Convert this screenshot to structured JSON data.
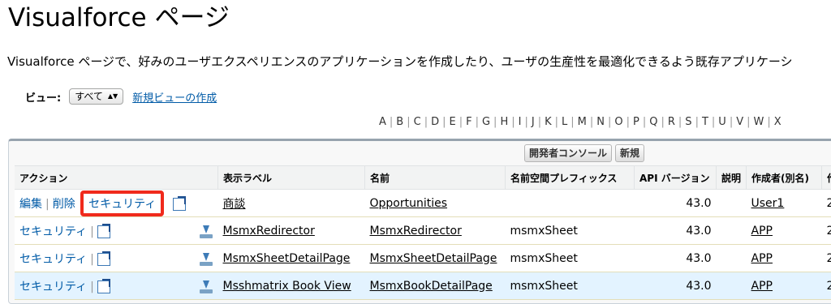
{
  "page": {
    "title": "Visualforce ページ",
    "description": "Visualforce ページで、好みのユーザエクスペリエンスのアプリケーションを作成したり、ユーザの生産性を最適化できるよう既存アプリケーシ"
  },
  "view": {
    "label": "ビュー:",
    "selected": "すべて",
    "new_view_link": "新規ビューの作成"
  },
  "alphabet": [
    "A",
    "B",
    "C",
    "D",
    "E",
    "F",
    "G",
    "H",
    "I",
    "J",
    "K",
    "L",
    "M",
    "N",
    "O",
    "P",
    "Q",
    "R",
    "S",
    "T",
    "U",
    "V",
    "W",
    "X"
  ],
  "buttons": {
    "dev_console": "開発者コンソール",
    "new": "新規"
  },
  "table": {
    "headers": [
      "アクション",
      "表示ラベル",
      "名前",
      "名前空間プレフィックス",
      "API バージョン",
      "説明",
      "作成者(別名)",
      "作"
    ],
    "rows": [
      {
        "edit": "編集",
        "delete": "削除",
        "security": "セキュリティ",
        "label": "商談",
        "name": "Opportunities",
        "ns": "",
        "api": "43.0",
        "desc": "",
        "creator": "User1",
        "extra": "2"
      },
      {
        "security": "セキュリティ",
        "label": "MsmxRedirector",
        "name": "MsmxRedirector",
        "ns": "msmxSheet",
        "api": "43.0",
        "desc": "",
        "creator": "APP",
        "extra": "2"
      },
      {
        "security": "セキュリティ",
        "label": "MsmxSheetDetailPage",
        "name": "MsmxSheetDetailPage",
        "ns": "msmxSheet",
        "api": "43.0",
        "desc": "",
        "creator": "APP",
        "extra": "2"
      },
      {
        "security": "セキュリティ",
        "label": "Msshmatrix Book View",
        "name": "MsmxBookDetailPage",
        "ns": "msmxSheet",
        "api": "43.0",
        "desc": "",
        "creator": "APP",
        "extra": "2"
      }
    ]
  },
  "colors": {
    "link": "#015ba7",
    "highlight": "#f02a1c",
    "row_highlight": "#e3f3ff"
  }
}
